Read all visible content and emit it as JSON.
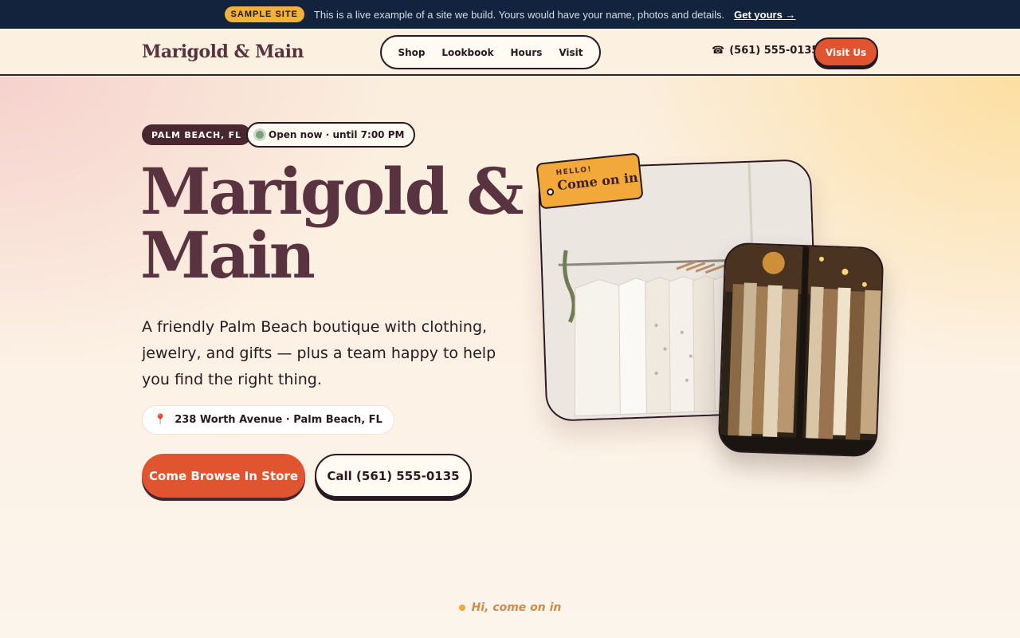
{
  "banner": {
    "tag": "SAMPLE SITE",
    "message": "This is a live example of a site we build. Yours would have your name, photos and details.",
    "cta": "Get yours →"
  },
  "header": {
    "logo": "Marigold & Main",
    "nav": [
      "Shop",
      "Lookbook",
      "Hours",
      "Visit"
    ],
    "phone_icon": "☎",
    "phone": "(561) 555-0135",
    "visit_button": "Visit Us"
  },
  "hero": {
    "location_badge": "PALM BEACH, FL",
    "open_status": "Open now · until 7:00 PM",
    "title": "Marigold & Main",
    "subtitle": "A friendly Palm Beach boutique with clothing, jewelry, and gifts — plus a team happy to help you find the right thing.",
    "address_icon": "📍",
    "address": "238 Worth Avenue · Palm Beach, FL",
    "primary_button": "Come Browse In Store",
    "secondary_button": "Call (561) 555-0135",
    "tag_small": "HELLO!",
    "tag_big": "Come on in"
  },
  "bottom_hint": "Hi, come on in",
  "colors": {
    "accent": "#e0552f",
    "brand_dark": "#5a3340",
    "banner_bg": "#13233d",
    "tag_yellow": "#f2a93a"
  }
}
